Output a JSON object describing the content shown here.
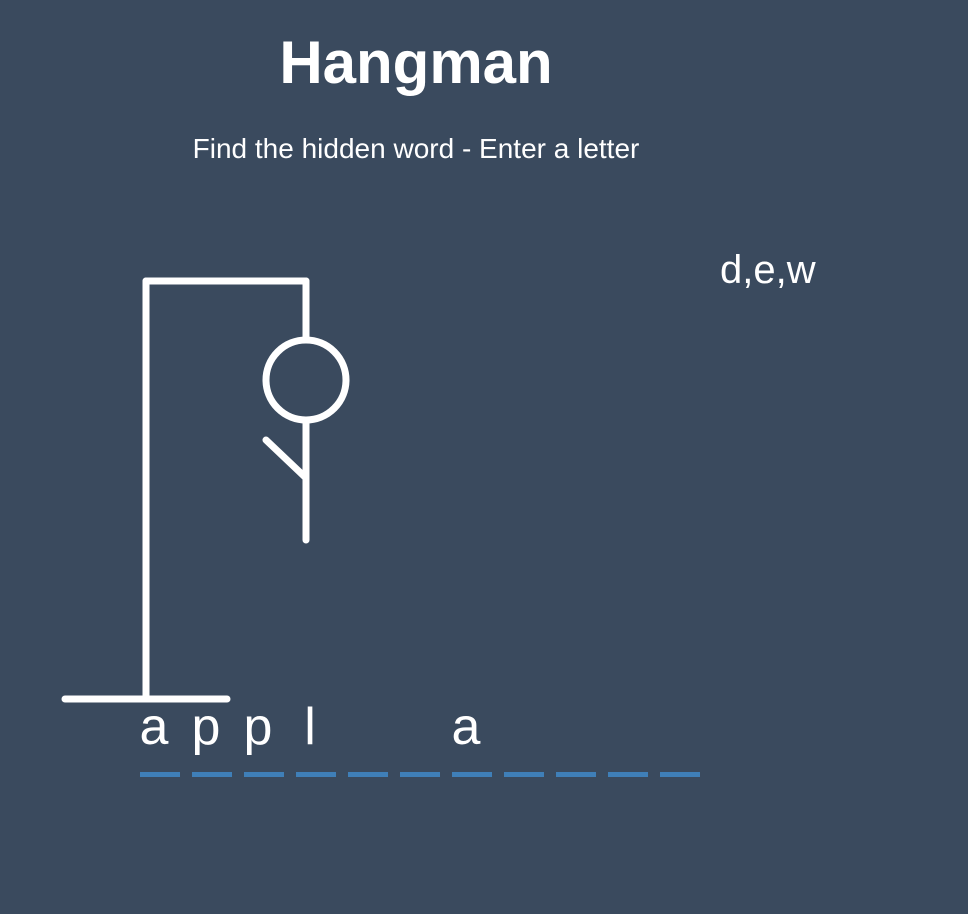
{
  "game": {
    "title": "Hangman",
    "subtitle": "Find the hidden word - Enter a letter",
    "wrong_letters": "d,e,w"
  },
  "word": {
    "slots": [
      "a",
      "p",
      "p",
      "l",
      "",
      "",
      "a",
      "",
      "",
      "",
      ""
    ]
  },
  "colors": {
    "background": "#3a4a5e",
    "foreground": "#ffffff",
    "dash": "#3f7fb8"
  }
}
